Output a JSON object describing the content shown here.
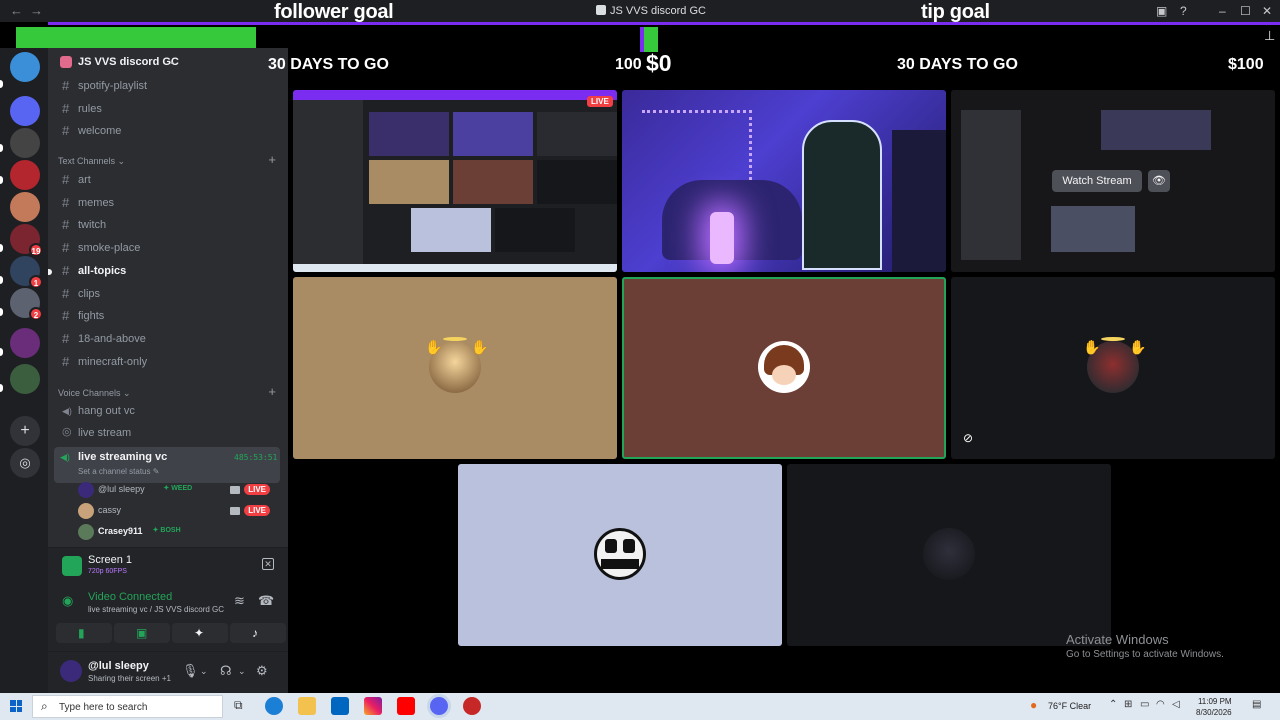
{
  "window": {
    "title": "JS VVS discord GC",
    "back_icon": "arrow-left",
    "forward_icon": "arrow-right"
  },
  "overlay": {
    "follower_goal_title": "follower goal",
    "tip_goal_title": "tip goal",
    "follower_days": "30 DAYS TO GO",
    "follower_target": "100",
    "tip_current": "$0",
    "tip_days": "30 DAYS TO GO",
    "tip_target": "$100",
    "follower_progress": 0.2
  },
  "rail": {
    "servers": [
      {
        "name": "server-1",
        "color": "#3b8ed8",
        "badge": ""
      },
      {
        "name": "server-2",
        "color": "#5865f2",
        "badge": ""
      },
      {
        "name": "server-3",
        "color": "#444",
        "badge": ""
      },
      {
        "name": "server-4",
        "color": "#b3262d",
        "badge": ""
      },
      {
        "name": "server-5",
        "color": "#c27a5a",
        "badge": ""
      },
      {
        "name": "server-6",
        "color": "#7b2531",
        "badge": "19"
      },
      {
        "name": "server-7",
        "color": "#30445f",
        "badge": "1"
      },
      {
        "name": "server-8",
        "color": "#5d6270",
        "badge": "2"
      },
      {
        "name": "server-9",
        "color": "#6a2d7a",
        "badge": ""
      },
      {
        "name": "server-10",
        "color": "#3b5e3f",
        "badge": ""
      }
    ],
    "add_icon": "plus-icon",
    "discover_icon": "compass-icon"
  },
  "sidebar": {
    "server_name": "JS VVS discord GC",
    "top_channels": [
      "spotify-playlist",
      "rules",
      "welcome"
    ],
    "text_category": "Text Channels",
    "text_channels": [
      {
        "name": "art",
        "unread": false
      },
      {
        "name": "memes",
        "unread": false
      },
      {
        "name": "twitch",
        "unread": false
      },
      {
        "name": "smoke-place",
        "unread": false
      },
      {
        "name": "all-topics",
        "unread": true
      },
      {
        "name": "clips",
        "unread": false
      },
      {
        "name": "fights",
        "unread": false
      },
      {
        "name": "18-and-above",
        "unread": false
      },
      {
        "name": "minecraft-only",
        "unread": false
      }
    ],
    "voice_category": "Voice Channels",
    "voice_channels": [
      "hang out vc",
      "live stream"
    ],
    "active_vc": {
      "name": "live streaming vc",
      "timer": "485:53:51",
      "status": "Set a channel status"
    },
    "members": [
      {
        "name": "@lul sleepy",
        "tag": "WEED",
        "live": "LIVE",
        "color": "#3b2a7a"
      },
      {
        "name": "cassy",
        "tag": "",
        "live": "LIVE",
        "color": "#c7a27a"
      },
      {
        "name": "Crasey911",
        "tag": "BOSH",
        "live": "",
        "color": "#5a7a5a"
      }
    ]
  },
  "screen_share": {
    "title": "Screen 1",
    "quality": "720p 60FPS"
  },
  "voice": {
    "status": "Video Connected",
    "location": "live streaming vc / JS VVS discord GC"
  },
  "user": {
    "name": "@lul sleepy",
    "status": "Sharing their screen +1"
  },
  "stream": {
    "live_label": "LIVE",
    "watch_label": "Watch Stream"
  },
  "activation": {
    "title": "Activate Windows",
    "subtitle": "Go to Settings to activate Windows."
  },
  "taskbar": {
    "search_placeholder": "Type here to search",
    "weather": "76°F  Clear",
    "time": "11:09 PM",
    "date": "8/30/2026"
  },
  "colors": {
    "accent_green": "#35c93b",
    "accent_purple": "#7a2df0",
    "live_red": "#f23f43",
    "discord_bg": "#2b2d31"
  }
}
